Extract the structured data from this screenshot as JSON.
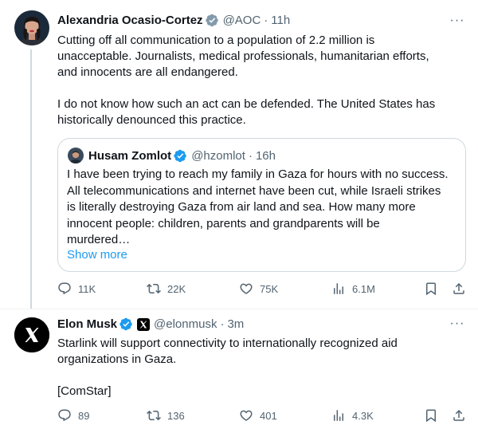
{
  "tweets": [
    {
      "author": {
        "name": "Alexandria Ocasio-Cortez",
        "handle": "@AOC",
        "verified_badge": "gray-check-icon"
      },
      "time": "11h",
      "text_paragraphs": [
        [
          "Cutting off all communication to a population of 2.2 million is",
          "unacceptable. Journalists, medical professionals, humanitarian efforts,",
          "and innocents are all endangered."
        ],
        [
          "I do not know how such an act can be defended. The United States has",
          "historically denounced this practice."
        ]
      ],
      "quote": {
        "author": {
          "name": "Husam Zomlot",
          "handle": "@hzomlot",
          "verified_badge": "blue-check-icon"
        },
        "time": "16h",
        "text_lines": [
          "I have been trying to reach my family in Gaza for hours with no success.",
          "All telecommunications and internet have been cut, while Israeli strikes",
          "is literally destroying Gaza from air land and sea. How many more",
          "innocent people: children, parents and grandparents will be",
          "murdered…"
        ],
        "show_more": "Show more"
      },
      "actions": {
        "replies": "11K",
        "reposts": "22K",
        "likes": "75K",
        "views": "6.1M"
      }
    },
    {
      "author": {
        "name": "Elon Musk",
        "handle": "@elonmusk",
        "verified_badge": "blue-check-icon",
        "affiliate": "x-logo-icon"
      },
      "time": "3m",
      "text_paragraphs": [
        [
          "Starlink will support connectivity to internationally recognized aid",
          "organizations in Gaza."
        ],
        [
          "[ComStar]"
        ]
      ],
      "actions": {
        "replies": "89",
        "reposts": "136",
        "likes": "401",
        "views": "4.3K"
      }
    }
  ],
  "dot": "·",
  "colors": {
    "text": "#0f1419",
    "secondary": "#536471",
    "link": "#1d9bf0",
    "border": "#cfd9de",
    "verified_blue": "#1d9bf0",
    "verified_gray": "#829aab"
  }
}
